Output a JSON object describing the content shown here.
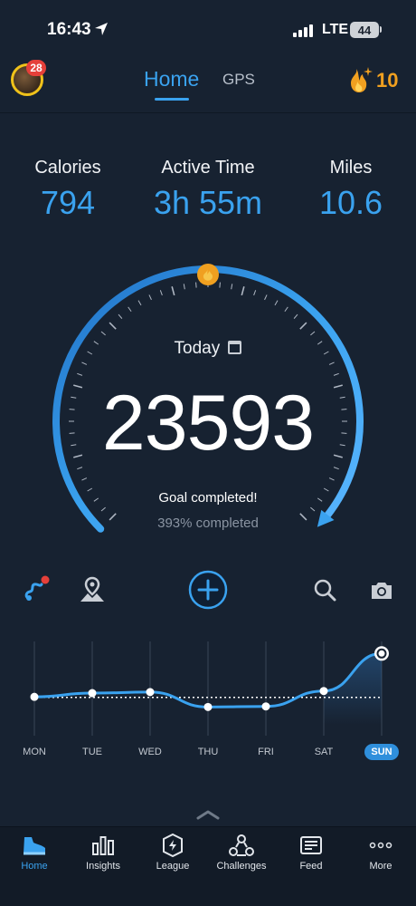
{
  "status_bar": {
    "time": "16:43",
    "network": "LTE",
    "battery": "44"
  },
  "header": {
    "avatar_badge": "28",
    "tabs": [
      {
        "label": "Home",
        "active": true
      },
      {
        "label": "GPS",
        "active": false
      }
    ],
    "streak_count": "10"
  },
  "stats": [
    {
      "label": "Calories",
      "value": "794"
    },
    {
      "label": "Active Time",
      "value": "3h 55m"
    },
    {
      "label": "Miles",
      "value": "10.6"
    }
  ],
  "ring": {
    "today_label": "Today",
    "steps": "23593",
    "goal_text": "Goal completed!",
    "percent_text": "393% completed",
    "progress_fraction": 1.0
  },
  "tools": {
    "route_icon": "route-icon",
    "map_icon": "map-pin-icon",
    "add_icon": "plus-icon",
    "search_icon": "search-icon",
    "camera_icon": "camera-icon"
  },
  "chart_data": {
    "type": "line",
    "categories": [
      "MON",
      "TUE",
      "WED",
      "THU",
      "FRI",
      "SAT",
      "SUN"
    ],
    "values": [
      6100,
      6800,
      7000,
      4200,
      4300,
      7200,
      23593
    ],
    "goal_line": 6000,
    "active_category": "SUN"
  },
  "bottom_nav": [
    {
      "label": "Home",
      "icon": "shoe-icon",
      "active": true
    },
    {
      "label": "Insights",
      "icon": "bar-chart-icon",
      "active": false
    },
    {
      "label": "League",
      "icon": "league-icon",
      "active": false
    },
    {
      "label": "Challenges",
      "icon": "challenges-icon",
      "active": false
    },
    {
      "label": "Feed",
      "icon": "feed-icon",
      "active": false
    },
    {
      "label": "More",
      "icon": "more-icon",
      "active": false
    }
  ],
  "colors": {
    "accent": "#3aa2ef",
    "background": "#172231",
    "streak": "#f0a020",
    "badge": "#e5403a"
  }
}
